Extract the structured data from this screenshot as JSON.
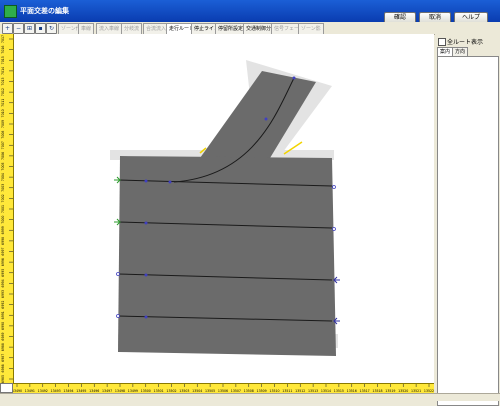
{
  "window": {
    "title": "平面交差の編集"
  },
  "header_buttons": {
    "confirm": "確認",
    "cancel": "取消",
    "help": "ヘルプ"
  },
  "toolbar": {
    "tabs": [
      {
        "label": "ゾーン作成",
        "state": "disabled"
      },
      {
        "label": "車線",
        "state": "disabled"
      },
      {
        "label": "流入車線",
        "state": "disabled"
      },
      {
        "label": "分岐流",
        "state": "disabled"
      },
      {
        "label": "合流流入",
        "state": "disabled"
      },
      {
        "label": "走行ルート",
        "state": "active"
      },
      {
        "label": "停止ライン",
        "state": "normal"
      },
      {
        "label": "停留所設定",
        "state": "normal"
      },
      {
        "label": "交通制御分",
        "state": "normal"
      },
      {
        "label": "信号フェーズ",
        "state": "disabled"
      },
      {
        "label": "ゾーン影",
        "state": "disabled"
      }
    ]
  },
  "left_ruler": {
    "labels": [
      "6985",
      "6986",
      "6987",
      "6988",
      "6989",
      "6990",
      "6991",
      "6992",
      "6993",
      "6994",
      "6995",
      "6996",
      "6997",
      "6998",
      "6999",
      "7000",
      "7001",
      "7002",
      "7003",
      "7004",
      "7005",
      "7006",
      "7007",
      "7008",
      "7009",
      "7010",
      "7011",
      "7012",
      "7013",
      "7014",
      "7015",
      "7016",
      "7017"
    ]
  },
  "bottom_ruler": {
    "labels": [
      "13490",
      "13491",
      "13492",
      "13493",
      "13494",
      "13495",
      "13496",
      "13497",
      "13498",
      "13499",
      "13500",
      "13501",
      "13502",
      "13503",
      "13504",
      "13505",
      "13506",
      "13507",
      "13508",
      "13509",
      "13510",
      "13511",
      "13512",
      "13513",
      "13514",
      "13515",
      "13516",
      "13517",
      "13518",
      "13519",
      "13520",
      "13521",
      "13522"
    ]
  },
  "right_panel": {
    "checkbox_label": "全ルート表示",
    "tabs": [
      "案内",
      "方向"
    ]
  },
  "colors": {
    "road": "#6b6b6b",
    "lane_line": "#1a1a1a",
    "node": "#4040c0",
    "ruler": "#ffe83a",
    "titlebar": "#0a3cb0"
  }
}
